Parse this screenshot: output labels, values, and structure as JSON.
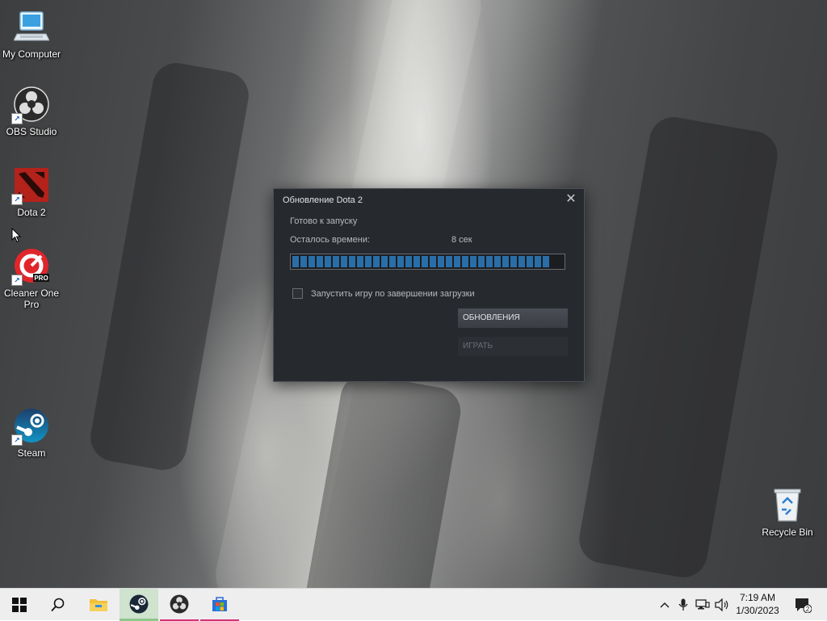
{
  "desktop": {
    "icons": [
      {
        "label": "My Computer",
        "icon": "computer-icon"
      },
      {
        "label": "OBS Studio",
        "icon": "obs-icon"
      },
      {
        "label": "Dota 2",
        "icon": "dota-icon"
      },
      {
        "label": "Cleaner One Pro",
        "icon": "cleaner-icon",
        "badge": "PRO"
      },
      {
        "label": "Steam",
        "icon": "steam-icon"
      },
      {
        "label": "Recycle Bin",
        "icon": "recycle-bin-icon"
      }
    ]
  },
  "dialog": {
    "title": "Обновление Dota 2",
    "close_glyph": "✕",
    "status": "Готово к запуску",
    "time_label": "Осталось времени:",
    "time_value": "8 сек",
    "progress": 0.95,
    "checkbox_label": "Запустить игру по завершении загрузки",
    "checkbox_checked": false,
    "updates_button": "ОБНОВЛЕНИЯ",
    "play_button": "ИГРАТЬ"
  },
  "taskbar": {
    "apps": [
      "start-icon",
      "search-icon",
      "file-explorer-icon",
      "steam-icon",
      "obs-icon",
      "microsoft-store-icon"
    ],
    "tray": {
      "chevron": "^",
      "time": "7:19 AM",
      "date": "1/30/2023",
      "notification_count": "2"
    }
  },
  "colors": {
    "dialog_bg": "#26292e",
    "progress_fill": "#2a6ea8",
    "taskbar_bg": "#eeeeef"
  }
}
